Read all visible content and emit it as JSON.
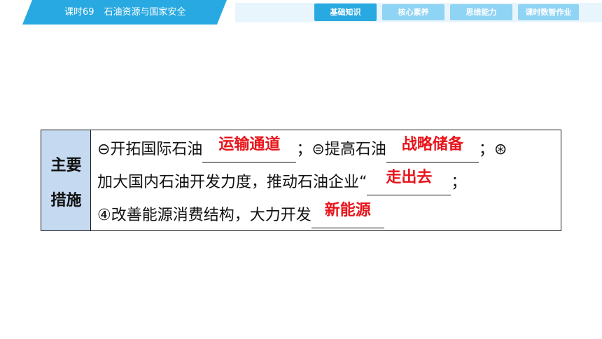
{
  "header": {
    "lesson": "课时69",
    "topic": "石油资源与国家安全",
    "tabs": [
      {
        "label": "基础知识",
        "active": true
      },
      {
        "label": "核心素养",
        "active": false
      },
      {
        "label": "思维能力",
        "active": false
      },
      {
        "label": "课时数智作业",
        "active": false
      }
    ]
  },
  "table": {
    "label_line1": "主要",
    "label_line2": "措施",
    "row1": {
      "t1": "⊖开拓国际石油",
      "a1": "运输通道",
      "t2": "；⊜提高石油",
      "a2": "战略储备",
      "t3": "；⊛"
    },
    "row2": {
      "t1": "加大国内石油开发力度，推动石油企业“",
      "a1": "走出去",
      "t2": "；"
    },
    "row3": {
      "t1": "④改善能源消费结构，大力开发",
      "a1": "新能源"
    }
  },
  "colors": {
    "header_blue": "#29a9e1",
    "tab_inactive": "#8fd3f5",
    "label_cell_bg": "#c5d9f1",
    "answer_red": "#e8141b"
  }
}
